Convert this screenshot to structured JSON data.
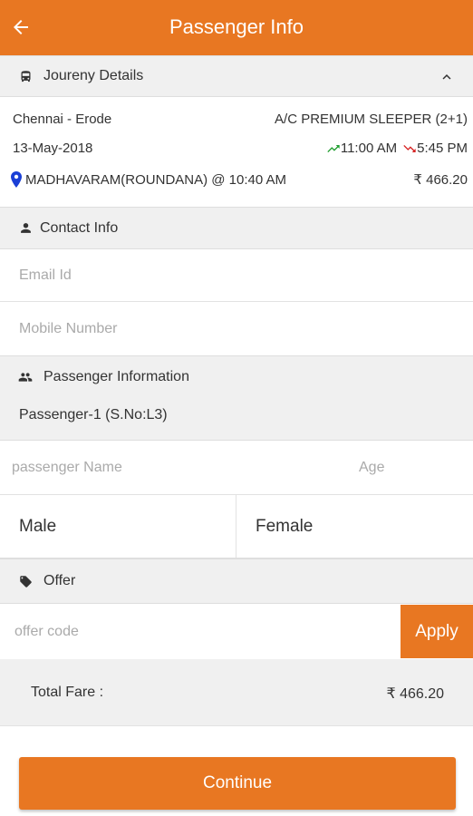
{
  "appbar": {
    "title": "Passenger Info",
    "back_icon": "arrow-left-icon"
  },
  "journey": {
    "header": "Joureny Details",
    "route": "Chennai - Erode",
    "bus_type": "A/C PREMIUM SLEEPER (2+1)",
    "date": "13-May-2018",
    "departure": "11:00 AM",
    "arrival": "5:45 PM",
    "boarding_point": "MADHAVARAM(ROUNDANA) @ 10:40 AM",
    "fare": "₹ 466.20"
  },
  "contact": {
    "header": "Contact Info",
    "email_placeholder": "Email Id",
    "mobile_placeholder": "Mobile Number"
  },
  "passenger": {
    "header": "Passenger Information",
    "label": "Passenger-1 (S.No:L3)",
    "name_placeholder": "passenger Name",
    "age_placeholder": "Age",
    "gender_options": [
      "Male",
      "Female"
    ]
  },
  "offer": {
    "header": "Offer",
    "code_placeholder": "offer code",
    "apply_label": "Apply"
  },
  "total": {
    "label": "Total Fare :",
    "value": "₹ 466.20"
  },
  "continue_label": "Continue",
  "colors": {
    "accent": "#e87722",
    "section_bg": "#f0f0f0",
    "pin": "#1a3fd6"
  }
}
